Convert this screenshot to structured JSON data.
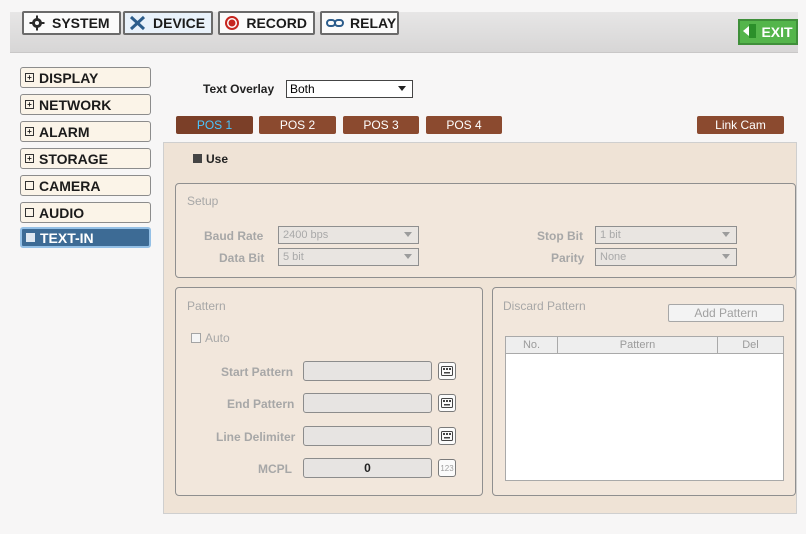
{
  "top_nav": {
    "system": "SYSTEM",
    "device": "DEVICE",
    "record": "RECORD",
    "relay": "RELAY",
    "exit": "EXIT"
  },
  "sidebar": {
    "items": [
      {
        "label": "DISPLAY"
      },
      {
        "label": "NETWORK"
      },
      {
        "label": "ALARM"
      },
      {
        "label": "STORAGE"
      },
      {
        "label": "CAMERA"
      },
      {
        "label": "AUDIO"
      },
      {
        "label": "TEXT-IN"
      }
    ]
  },
  "text_overlay": {
    "label": "Text Overlay",
    "value": "Both"
  },
  "pos_tabs": [
    "POS 1",
    "POS 2",
    "POS 3",
    "POS 4"
  ],
  "link_cam_label": "Link Cam",
  "use_label": "Use",
  "setup": {
    "title": "Setup",
    "baud_rate_label": "Baud Rate",
    "baud_rate_value": "2400 bps",
    "data_bit_label": "Data Bit",
    "data_bit_value": "5 bit",
    "stop_bit_label": "Stop Bit",
    "stop_bit_value": "1 bit",
    "parity_label": "Parity",
    "parity_value": "None"
  },
  "pattern": {
    "title": "Pattern",
    "auto_label": "Auto",
    "start_label": "Start Pattern",
    "end_label": "End Pattern",
    "line_delim_label": "Line Delimiter",
    "mcpl_label": "MCPL",
    "mcpl_value": "0",
    "num_pad_label": "123"
  },
  "discard": {
    "title": "Discard Pattern",
    "add_button": "Add Pattern",
    "headers": [
      "No.",
      "Pattern",
      "Del"
    ]
  },
  "colors": {
    "tab_bg": "#8b4a2f",
    "tab_active_text": "#49c6ff",
    "active_sidebar": "#3d6b95",
    "exit_green": "#54b54b"
  }
}
